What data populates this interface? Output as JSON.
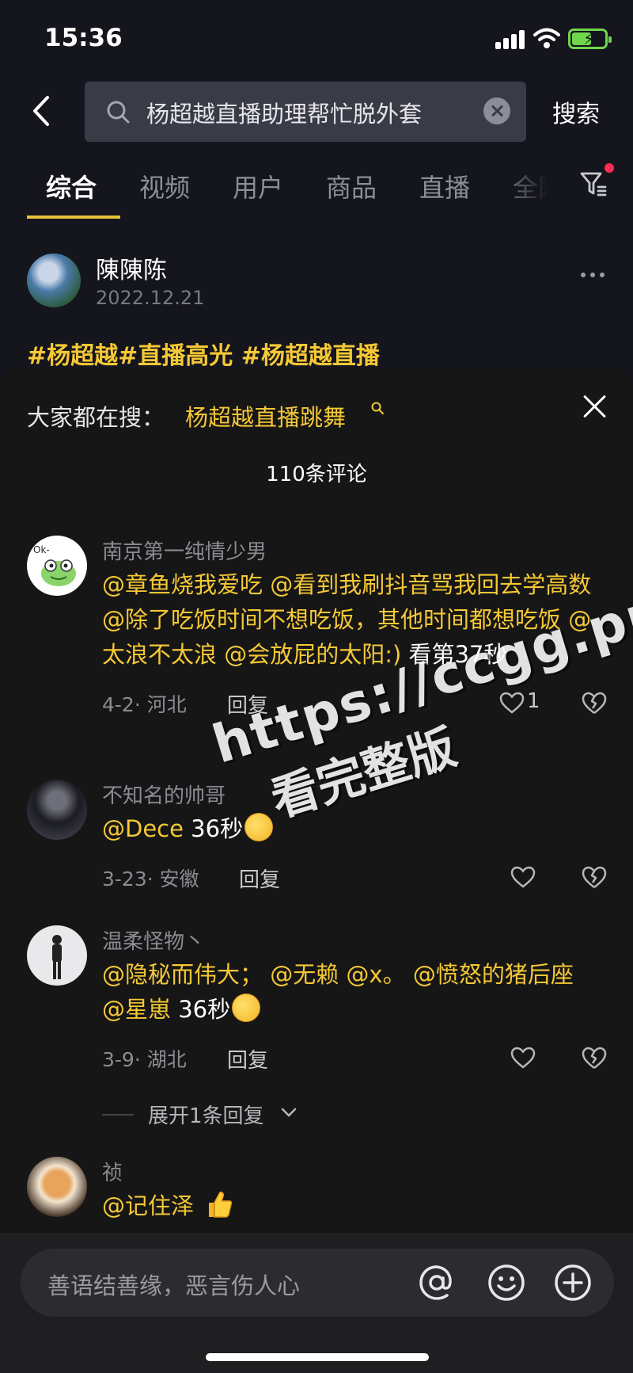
{
  "status_bar": {
    "time": "15:36"
  },
  "search": {
    "query": "杨超越直播助理帮忙脱外套",
    "submit_label": "搜索"
  },
  "tabs": [
    {
      "label": "综合",
      "active": true
    },
    {
      "label": "视频"
    },
    {
      "label": "用户"
    },
    {
      "label": "商品"
    },
    {
      "label": "直播"
    },
    {
      "label": "全网"
    }
  ],
  "post": {
    "author": "陳陳陈",
    "date": "2022.12.21",
    "tags": "#杨超越#直播高光   #杨超越直播"
  },
  "comments_panel": {
    "trending_label": "大家都在搜：",
    "trending_term": "杨超越直播跳舞",
    "count_label": "110条评论",
    "comments": [
      {
        "name": "南京第一纯情少男",
        "text_mentions": "@章鱼烧我爱吃 @看到我刷抖音骂我回去学高数 @除了吃饭时间不想吃饭，其他时间都想吃饭 @太浪不太浪 @会放屁的太阳:)",
        "text_rest": " 看第37秒",
        "date_location": "4-2· 河北",
        "reply_label": "回复",
        "likes": "1"
      },
      {
        "name": "不知名的帅哥",
        "text_mentions": "@Dece",
        "text_rest": " 36秒",
        "date_location": "3-23· 安徽",
        "reply_label": "回复",
        "likes": ""
      },
      {
        "name": "温柔怪物丶",
        "text_mentions": "@隐秘而伟大； @无赖 @x。 @愤怒的猪后座 @星崽",
        "text_rest": " 36秒",
        "date_location": "3-9· 湖北",
        "reply_label": "回复",
        "likes": "",
        "expand_label": "展开1条回复"
      },
      {
        "name": "祯",
        "text_mentions": "@记住泽",
        "text_rest": " "
      }
    ]
  },
  "watermark": {
    "url": "https://ccgg.pro",
    "subtitle": "看完整版"
  },
  "input_bar": {
    "placeholder": "善语结善缘，恶言伤人心"
  },
  "colors": {
    "accent": "#f5c835",
    "background": "#15151d",
    "sheet": "#161616",
    "notification_dot": "#fd2c55"
  }
}
